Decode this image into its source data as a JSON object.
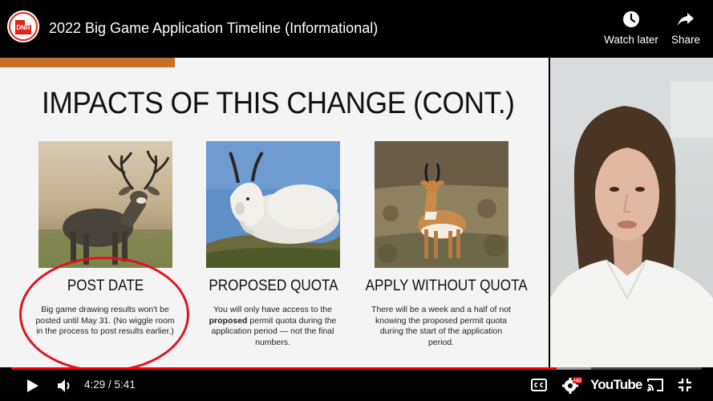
{
  "video": {
    "title": "2022 Big Game Application Timeline (Informational)",
    "channel_logo_text": "DNR"
  },
  "top_actions": {
    "watch_later": "Watch later",
    "share": "Share"
  },
  "slide": {
    "title": "IMPACTS OF THIS CHANGE (CONT.)",
    "cards": [
      {
        "heading": "POST DATE",
        "text": "Big game drawing results won't be posted until May 31. (No wiggle room in the process to post results earlier.)"
      },
      {
        "heading": "PROPOSED QUOTA",
        "text_before": "You will only have access to the ",
        "text_bold": "proposed",
        "text_after": " permit quota during the application period — not the final numbers."
      },
      {
        "heading": "APPLY WITHOUT QUOTA",
        "text": "There will be a week and a half of not knowing the proposed permit quota during the start of the application period."
      }
    ]
  },
  "controls": {
    "current_time": "4:29",
    "duration": "5:41",
    "time_separator": " / ",
    "played_fraction": 0.79,
    "buffered_fraction": 0.84,
    "hd_badge": "HD",
    "brand": "YouTube"
  },
  "colors": {
    "accent": "#c8702a",
    "progress": "#ff0000",
    "highlight_circle": "#e0141e"
  }
}
